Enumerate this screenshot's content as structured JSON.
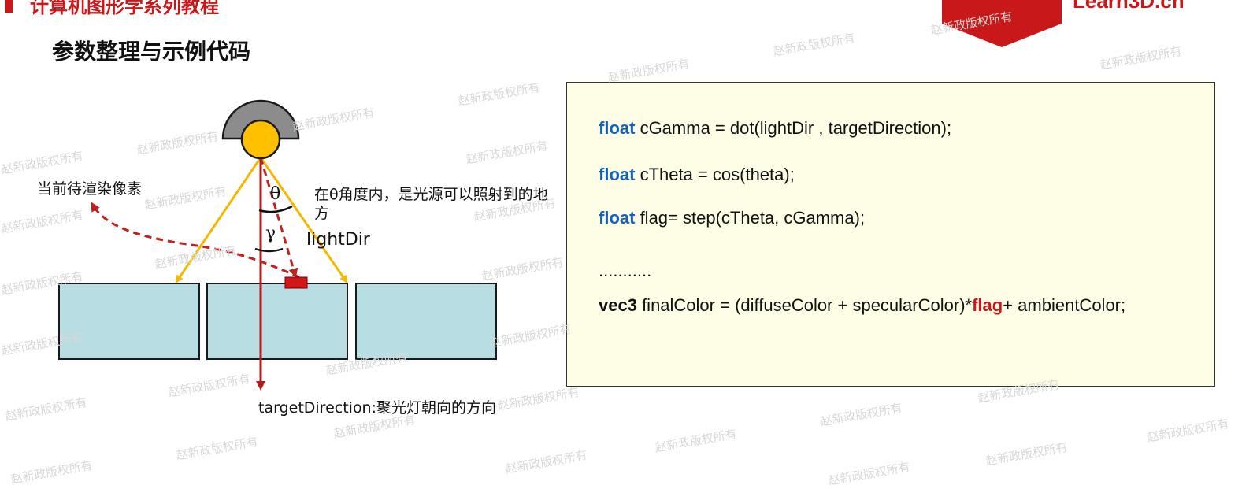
{
  "header": {
    "course_title": "计算机图形学系列教程",
    "logo_text": "Learn3D.cn"
  },
  "page_title": "参数整理与示例代码",
  "diagram": {
    "pixel_label": "当前待渲染像素",
    "theta_symbol": "θ",
    "gamma_symbol": "γ",
    "theta_note_line1": "在θ角度内，是光源可以照射到的地",
    "theta_note_line2": "方",
    "light_dir_label": "lightDir",
    "target_direction_label": "targetDirection:聚光灯朝向的方向",
    "colors": {
      "light_body": "#ffc000",
      "lamp_shade": "#8c8c8c",
      "spot_rays": "#f5b800",
      "target_arrow": "#b01c1c",
      "dashed_path": "#c0231f",
      "surface_fill": "#b8dde3",
      "pixel_fill": "#d01818"
    }
  },
  "code": {
    "line1": {
      "keyword": "float",
      "rest": " cGamma = dot(lightDir , targetDirection);"
    },
    "line2": {
      "keyword": "float",
      "rest": " cTheta = cos(theta);"
    },
    "line3": {
      "keyword": "float",
      "rest": " flag= step(cTheta, cGamma);"
    },
    "line4": {
      "text": "..........."
    },
    "line5": {
      "keyword": "vec3",
      "middle": " finalColor = (diffuseColor + specularColor)*",
      "flag": "flag",
      "end": "+ ambientColor;"
    }
  },
  "colors": {
    "accent_red": "#c8181a",
    "keyword_blue": "#1560b8",
    "code_bg": "#fefde6"
  },
  "watermark_text": "赵新政版权所有"
}
